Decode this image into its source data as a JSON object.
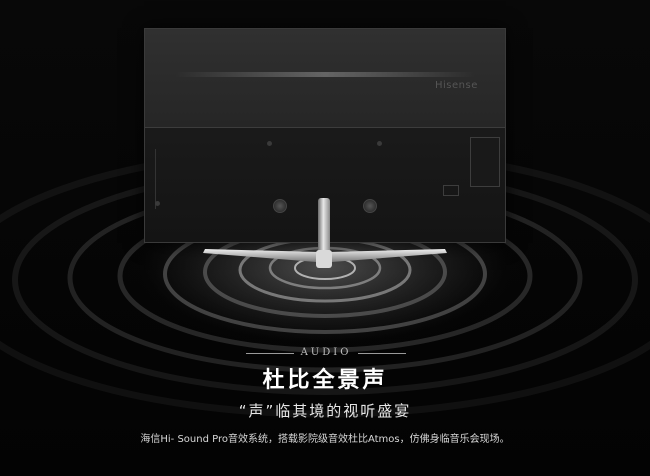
{
  "tv": {
    "brand_logo": "Hisense"
  },
  "audio": {
    "label": "AUDIO"
  },
  "headline": "杜比全景声",
  "subheadline": "“声”临其境的视听盛宴",
  "description": "海信Hi- Sound Pro音效系统，搭载影院级音效杜比Atmos，仿佛身临音乐会现场。",
  "colors": {
    "background": "#050505",
    "text_primary": "#ffffff",
    "text_secondary": "#bdbdbd"
  }
}
